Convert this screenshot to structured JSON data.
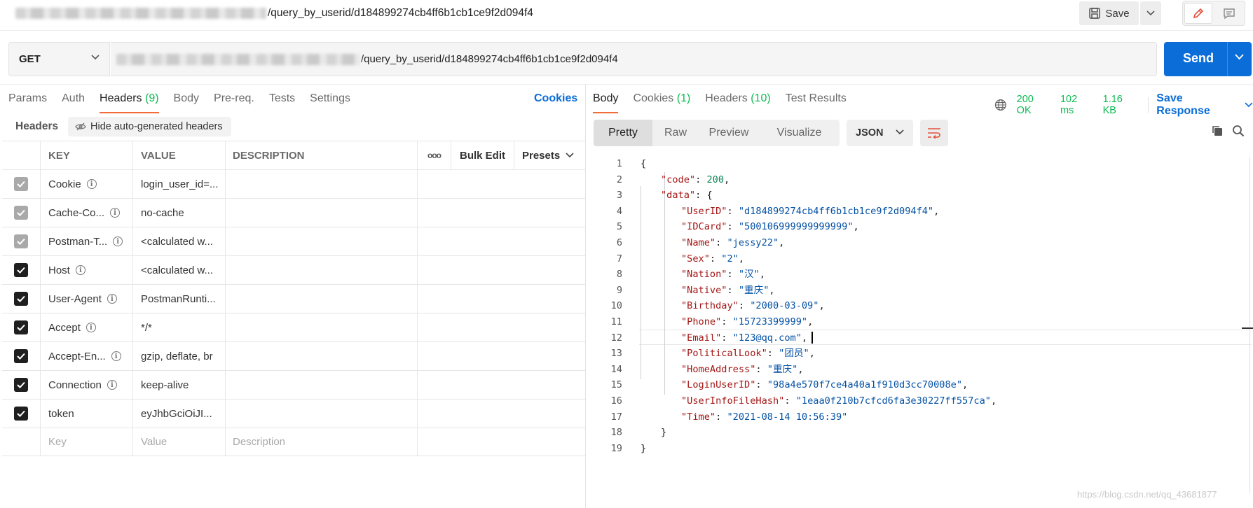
{
  "top": {
    "url_suffix": "/query_by_userid/d184899274cb4ff6b1cb1ce9f2d094f4",
    "save_label": "Save"
  },
  "request": {
    "method": "GET",
    "url_suffix": "/query_by_userid/d184899274cb4ff6b1cb1ce9f2d094f4",
    "send_label": "Send"
  },
  "left_tabs": [
    {
      "label": "Params",
      "count": ""
    },
    {
      "label": "Auth",
      "count": ""
    },
    {
      "label": "Headers",
      "count": "(9)"
    },
    {
      "label": "Body",
      "count": ""
    },
    {
      "label": "Pre-req.",
      "count": ""
    },
    {
      "label": "Tests",
      "count": ""
    },
    {
      "label": "Settings",
      "count": ""
    }
  ],
  "cookies_link": "Cookies",
  "headers_section": {
    "label": "Headers",
    "hide_auto": "Hide auto-generated headers"
  },
  "table": {
    "columns": {
      "key": "KEY",
      "value": "VALUE",
      "description": "DESCRIPTION",
      "more": "ooo",
      "bulk_edit": "Bulk Edit",
      "presets": "Presets"
    },
    "rows": [
      {
        "key": "Cookie",
        "value": "login_user_id=...",
        "checked": "dim",
        "info": true
      },
      {
        "key": "Cache-Co...",
        "value": "no-cache",
        "checked": "dim",
        "info": true
      },
      {
        "key": "Postman-T...",
        "value": "<calculated w...",
        "checked": "dim",
        "info": true
      },
      {
        "key": "Host",
        "value": "<calculated w...",
        "checked": "on",
        "info": true
      },
      {
        "key": "User-Agent",
        "value": "PostmanRunti...",
        "checked": "on",
        "info": true
      },
      {
        "key": "Accept",
        "value": "*/*",
        "checked": "on",
        "info": true
      },
      {
        "key": "Accept-En...",
        "value": "gzip, deflate, br",
        "checked": "on",
        "info": true
      },
      {
        "key": "Connection",
        "value": "keep-alive",
        "checked": "on",
        "info": true
      },
      {
        "key": "token",
        "value": "eyJhbGciOiJI...",
        "checked": "on",
        "info": false
      }
    ],
    "placeholders": {
      "key": "Key",
      "value": "Value",
      "description": "Description"
    }
  },
  "right_tabs": [
    {
      "label": "Body",
      "count": ""
    },
    {
      "label": "Cookies",
      "count": "(1)"
    },
    {
      "label": "Headers",
      "count": "(10)"
    },
    {
      "label": "Test Results",
      "count": ""
    }
  ],
  "status": {
    "code": "200 OK",
    "time": "102 ms",
    "size": "1.16 KB",
    "save_response": "Save Response"
  },
  "view_modes": [
    "Pretty",
    "Raw",
    "Preview",
    "Visualize"
  ],
  "format": "JSON",
  "watermark": "https://blog.csdn.net/qq_43681877",
  "colors": {
    "accent": "#0a6dd8",
    "tab_underline": "#f26b3a",
    "success": "#0cbb52",
    "json_key": "#a31515",
    "json_string": "#0451a5",
    "json_number": "#098658"
  },
  "json_lines": [
    {
      "n": "1",
      "indent": 0,
      "parts": [
        [
          "p",
          "{"
        ]
      ]
    },
    {
      "n": "2",
      "indent": 1,
      "parts": [
        [
          "k",
          "\"code\""
        ],
        [
          "p",
          ": "
        ],
        [
          "n",
          "200"
        ],
        [
          "p",
          ","
        ]
      ]
    },
    {
      "n": "3",
      "indent": 1,
      "parts": [
        [
          "k",
          "\"data\""
        ],
        [
          "p",
          ": {"
        ]
      ]
    },
    {
      "n": "4",
      "indent": 2,
      "parts": [
        [
          "k",
          "\"UserID\""
        ],
        [
          "p",
          ": "
        ],
        [
          "s",
          "\"d184899274cb4ff6b1cb1ce9f2d094f4\""
        ],
        [
          "p",
          ","
        ]
      ]
    },
    {
      "n": "5",
      "indent": 2,
      "parts": [
        [
          "k",
          "\"IDCard\""
        ],
        [
          "p",
          ": "
        ],
        [
          "s",
          "\"500106999999999999\""
        ],
        [
          "p",
          ","
        ]
      ]
    },
    {
      "n": "6",
      "indent": 2,
      "parts": [
        [
          "k",
          "\"Name\""
        ],
        [
          "p",
          ": "
        ],
        [
          "s",
          "\"jessy22\""
        ],
        [
          "p",
          ","
        ]
      ]
    },
    {
      "n": "7",
      "indent": 2,
      "parts": [
        [
          "k",
          "\"Sex\""
        ],
        [
          "p",
          ": "
        ],
        [
          "s",
          "\"2\""
        ],
        [
          "p",
          ","
        ]
      ]
    },
    {
      "n": "8",
      "indent": 2,
      "parts": [
        [
          "k",
          "\"Nation\""
        ],
        [
          "p",
          ": "
        ],
        [
          "s",
          "\"汉\""
        ],
        [
          "p",
          ","
        ]
      ]
    },
    {
      "n": "9",
      "indent": 2,
      "parts": [
        [
          "k",
          "\"Native\""
        ],
        [
          "p",
          ": "
        ],
        [
          "s",
          "\"重庆\""
        ],
        [
          "p",
          ","
        ]
      ]
    },
    {
      "n": "10",
      "indent": 2,
      "parts": [
        [
          "k",
          "\"Birthday\""
        ],
        [
          "p",
          ": "
        ],
        [
          "s",
          "\"2000-03-09\""
        ],
        [
          "p",
          ","
        ]
      ]
    },
    {
      "n": "11",
      "indent": 2,
      "parts": [
        [
          "k",
          "\"Phone\""
        ],
        [
          "p",
          ": "
        ],
        [
          "s",
          "\"15723399999\""
        ],
        [
          "p",
          ","
        ]
      ]
    },
    {
      "n": "12",
      "indent": 2,
      "parts": [
        [
          "k",
          "\"Email\""
        ],
        [
          "p",
          ": "
        ],
        [
          "s",
          "\"123@qq.com\""
        ],
        [
          "p",
          ","
        ]
      ]
    },
    {
      "n": "13",
      "indent": 2,
      "parts": [
        [
          "k",
          "\"PoliticalLook\""
        ],
        [
          "p",
          ": "
        ],
        [
          "s",
          "\"团员\""
        ],
        [
          "p",
          ","
        ]
      ]
    },
    {
      "n": "14",
      "indent": 2,
      "parts": [
        [
          "k",
          "\"HomeAddress\""
        ],
        [
          "p",
          ": "
        ],
        [
          "s",
          "\"重庆\""
        ],
        [
          "p",
          ","
        ]
      ]
    },
    {
      "n": "15",
      "indent": 2,
      "parts": [
        [
          "k",
          "\"LoginUserID\""
        ],
        [
          "p",
          ": "
        ],
        [
          "s",
          "\"98a4e570f7ce4a40a1f910d3cc70008e\""
        ],
        [
          "p",
          ","
        ]
      ]
    },
    {
      "n": "16",
      "indent": 2,
      "parts": [
        [
          "k",
          "\"UserInfoFileHash\""
        ],
        [
          "p",
          ": "
        ],
        [
          "s",
          "\"1eaa0f210b7cfcd6fa3e30227ff557ca\""
        ],
        [
          "p",
          ","
        ]
      ]
    },
    {
      "n": "17",
      "indent": 2,
      "parts": [
        [
          "k",
          "\"Time\""
        ],
        [
          "p",
          ": "
        ],
        [
          "s",
          "\"2021-08-14 10:56:39\""
        ]
      ]
    },
    {
      "n": "18",
      "indent": 1,
      "parts": [
        [
          "p",
          "}"
        ]
      ]
    },
    {
      "n": "19",
      "indent": 0,
      "parts": [
        [
          "p",
          "}"
        ]
      ]
    }
  ]
}
